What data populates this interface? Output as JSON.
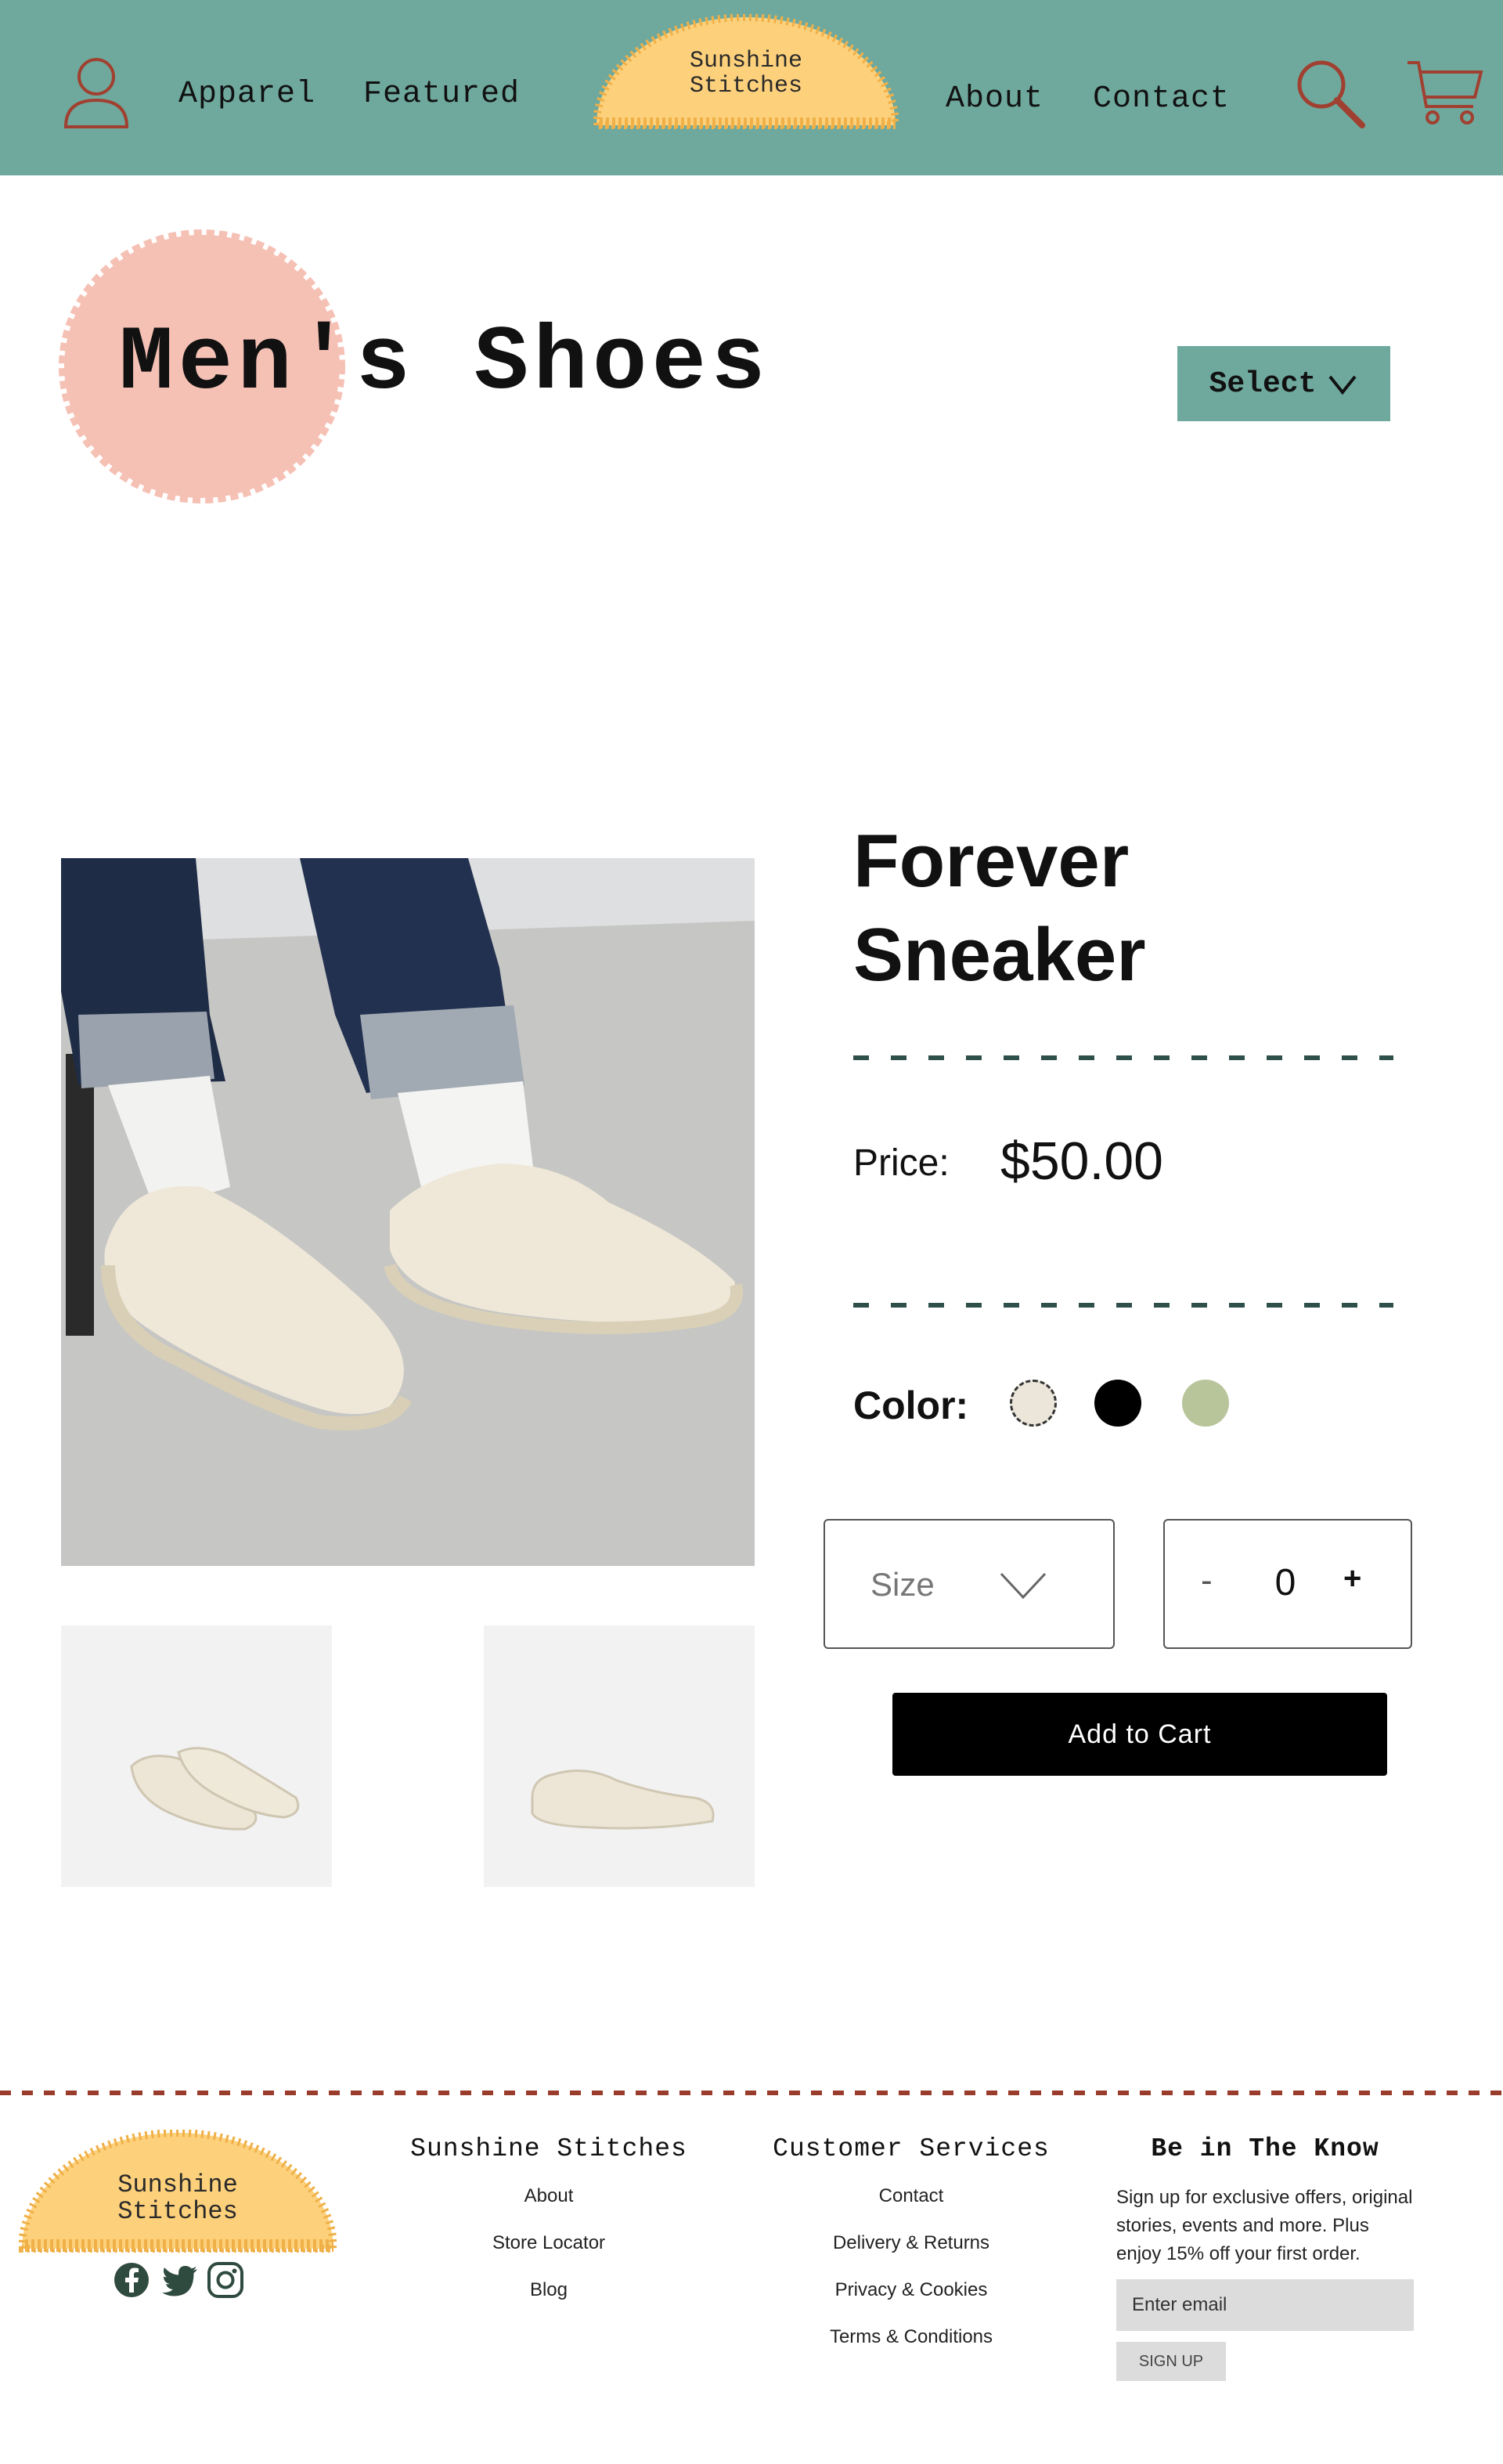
{
  "header": {
    "nav_left": [
      "Apparel",
      "Featured"
    ],
    "nav_right": [
      "About",
      "Contact"
    ],
    "logo": {
      "line1": "Sunshine",
      "line2": "Stitches"
    },
    "icons": {
      "user": "user-icon",
      "search": "search-icon",
      "cart": "cart-icon"
    }
  },
  "category": {
    "title": "Men's Shoes",
    "select_label": "Select"
  },
  "product": {
    "name": "Forever Sneaker",
    "price_label": "Price:",
    "price": "$50.00",
    "color_label": "Color:",
    "colors": [
      {
        "name": "cream",
        "hex": "#ece6da",
        "selected": true
      },
      {
        "name": "black",
        "hex": "#000000",
        "selected": false
      },
      {
        "name": "sage",
        "hex": "#b8c49a",
        "selected": false
      }
    ],
    "size_placeholder": "Size",
    "quantity": {
      "minus": "-",
      "value": "0",
      "plus": "+"
    },
    "add_to_cart": "Add to Cart"
  },
  "footer": {
    "logo": {
      "line1": "Sunshine",
      "line2": "Stitches"
    },
    "social": [
      "facebook-icon",
      "twitter-icon",
      "instagram-icon"
    ],
    "columns": [
      {
        "heading": "Sunshine Stitches",
        "links": [
          "About",
          "Store Locator",
          "Blog"
        ]
      },
      {
        "heading": "Customer Services",
        "links": [
          "Contact",
          "Delivery & Returns",
          "Privacy & Cookies",
          "Terms & Conditions"
        ]
      }
    ],
    "newsletter": {
      "heading": "Be in The Know",
      "text": "Sign up for exclusive offers, original stories, events and more. Plus enjoy 15% off your first order.",
      "placeholder": "Enter email",
      "button": "SIGN UP"
    }
  },
  "colors": {
    "header_bg": "#6fa99e",
    "accent_red": "#a04030",
    "logo_yellow": "#fdd17c",
    "blob_pink": "#f6c1b5",
    "button_black": "#000000"
  }
}
